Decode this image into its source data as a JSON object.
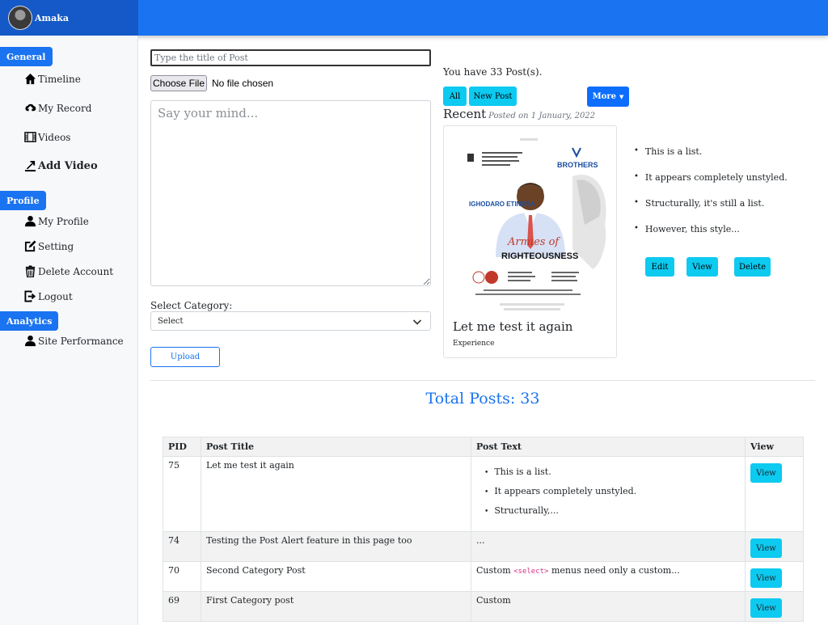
{
  "user": {
    "name": "Amaka"
  },
  "sidebar": {
    "sections": [
      {
        "label": "General"
      },
      {
        "label": "Profile"
      },
      {
        "label": "Analytics"
      }
    ],
    "items": [
      {
        "label": "Timeline",
        "icon": "home-icon"
      },
      {
        "label": "My Record",
        "icon": "cloud-upload-icon"
      },
      {
        "label": "Videos",
        "icon": "film-icon"
      },
      {
        "label": "Add Video",
        "icon": "upload-icon"
      },
      {
        "label": "My Profile",
        "icon": "person-icon"
      },
      {
        "label": "Setting",
        "icon": "edit-icon"
      },
      {
        "label": "Delete Account",
        "icon": "trash-icon"
      },
      {
        "label": "Logout",
        "icon": "logout-icon"
      },
      {
        "label": "Site Performance",
        "icon": "person-icon"
      }
    ]
  },
  "form": {
    "title_placeholder": "Type the title of Post",
    "file_button": "Choose File",
    "file_status": "No file chosen",
    "body_placeholder": "Say your mind...",
    "category_label": "Select Category:",
    "category_value": "Select",
    "upload_label": "Upload"
  },
  "posts_panel": {
    "count_text": "You have 33 Post(s).",
    "buttons": {
      "all": "All",
      "new_post": "New Post",
      "more": "More"
    },
    "recent_label": "Recent",
    "posted_text": "Posted on 1 January, 2022",
    "card": {
      "title": "Let me test it again",
      "category": "Experience",
      "flyer": {
        "name": "IGHODARO ETINOSA",
        "theme_top": "Armies of",
        "theme_bottom": "RIGHTEOUSNESS",
        "brand": "BROTHERS"
      }
    },
    "list": [
      "This is a list.",
      "It appears completely unstyled.",
      "Structurally, it's still a list.",
      "However, this style..."
    ],
    "actions": {
      "edit": "Edit",
      "view": "View",
      "delete": "Delete"
    }
  },
  "total_posts": "Total Posts: 33",
  "table": {
    "headers": [
      "PID",
      "Post Title",
      "Post Text",
      "View"
    ],
    "rows": [
      {
        "pid": "75",
        "title": "Let me test it again",
        "text_list": [
          "This is a list.",
          "It appears completely unstyled.",
          "Structurally,..."
        ],
        "view": "View"
      },
      {
        "pid": "74",
        "title": "Testing the Post Alert feature in this page too",
        "text": "...",
        "view": "View"
      },
      {
        "pid": "70",
        "title": "Second Category Post",
        "text_pre": "Custom",
        "text_code": "<select>",
        "text_post": "menus need only a custom...",
        "view": "View"
      },
      {
        "pid": "69",
        "title": "First Category post",
        "text": "Custom",
        "view": "View"
      }
    ]
  },
  "colors": {
    "primary": "#1a73f0",
    "info": "#0dcaf0",
    "brand_dark": "#1459c7"
  }
}
